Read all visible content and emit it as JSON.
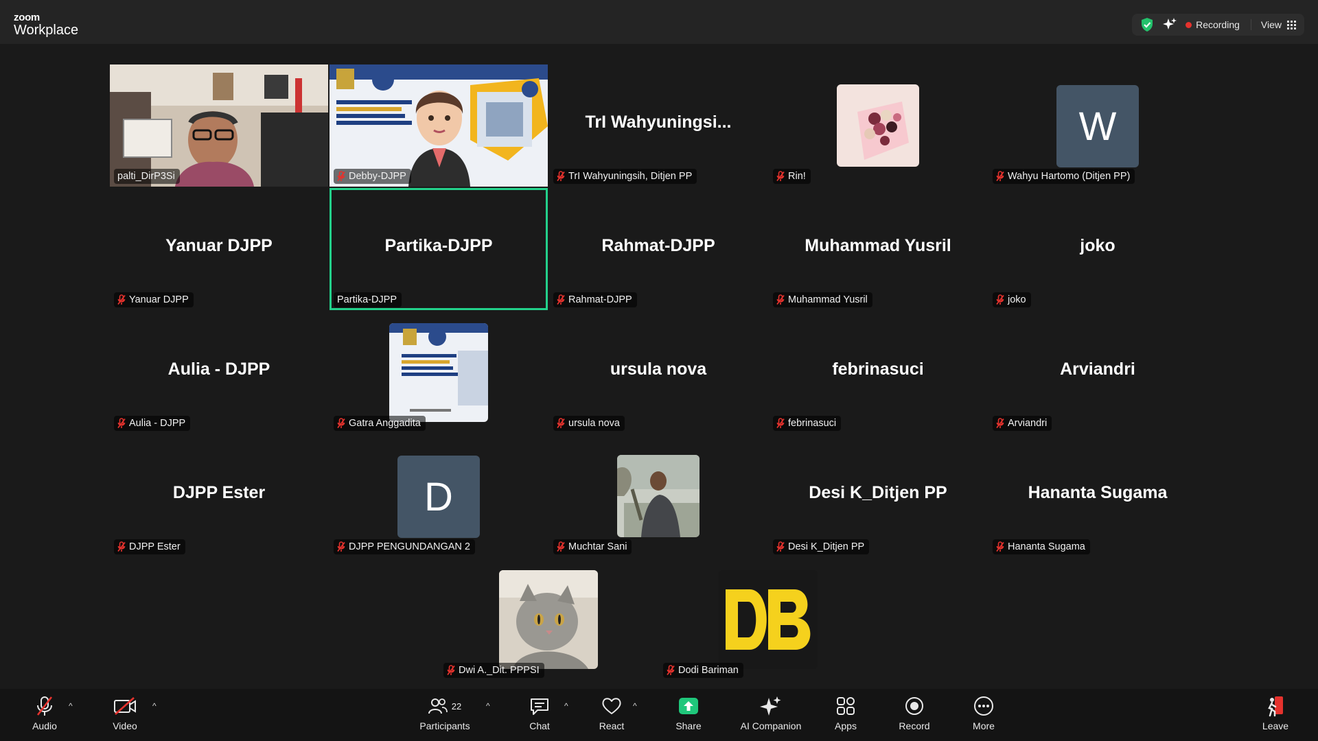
{
  "app": {
    "brand_small": "zoom",
    "brand_main": "Workplace"
  },
  "top_bar": {
    "recording_label": "Recording",
    "view_label": "View"
  },
  "tiles": [
    {
      "name": "palti_DirP3Si",
      "type": "video-person",
      "muted": false,
      "big": ""
    },
    {
      "name": "Debby-DJPP",
      "type": "avatar-slide",
      "muted": true,
      "big": ""
    },
    {
      "name": "TrI Wahyuningsih, Ditjen PP",
      "type": "text",
      "muted": true,
      "big": "TrI  Wahyuningsi..."
    },
    {
      "name": "Rin!",
      "type": "photo-flowers",
      "muted": true,
      "big": ""
    },
    {
      "name": "Wahyu Hartomo (Ditjen PP)",
      "type": "letter",
      "muted": true,
      "big": "W"
    },
    {
      "name": "Yanuar DJPP",
      "type": "text",
      "muted": true,
      "big": "Yanuar DJPP"
    },
    {
      "name": "Partika-DJPP",
      "type": "text",
      "muted": false,
      "big": "Partika-DJPP",
      "active": true
    },
    {
      "name": "Rahmat-DJPP",
      "type": "text",
      "muted": true,
      "big": "Rahmat-DJPP"
    },
    {
      "name": "Muhammad Yusril",
      "type": "text",
      "muted": true,
      "big": "Muhammad Yusril"
    },
    {
      "name": "joko",
      "type": "text",
      "muted": true,
      "big": "joko"
    },
    {
      "name": "Aulia - DJPP",
      "type": "text",
      "muted": true,
      "big": "Aulia - DJPP"
    },
    {
      "name": "Gatra Anggadita",
      "type": "photo-slide",
      "muted": true,
      "big": ""
    },
    {
      "name": "ursula nova",
      "type": "text",
      "muted": true,
      "big": "ursula nova"
    },
    {
      "name": "febrinasuci",
      "type": "text",
      "muted": true,
      "big": "febrinasuci"
    },
    {
      "name": "Arviandri",
      "type": "text",
      "muted": true,
      "big": "Arviandri"
    },
    {
      "name": "DJPP Ester",
      "type": "text",
      "muted": true,
      "big": "DJPP Ester"
    },
    {
      "name": "DJPP PENGUNDANGAN 2",
      "type": "letter",
      "muted": true,
      "big": "D"
    },
    {
      "name": "Muchtar Sani",
      "type": "photo-man",
      "muted": true,
      "big": ""
    },
    {
      "name": "Desi K_Ditjen PP",
      "type": "text",
      "muted": true,
      "big": "Desi K_Ditjen PP"
    },
    {
      "name": "Hananta Sugama",
      "type": "text",
      "muted": true,
      "big": "Hananta Sugama"
    },
    {
      "name": "Dwi A._Dit. PPPSI",
      "type": "photo-cat",
      "muted": true,
      "big": ""
    },
    {
      "name": "Dodi Bariman",
      "type": "photo-db",
      "muted": true,
      "big": ""
    }
  ],
  "toolbar": {
    "audio": "Audio",
    "video": "Video",
    "participants": "Participants",
    "participants_count": "22",
    "chat": "Chat",
    "react": "React",
    "share": "Share",
    "ai_companion": "AI Companion",
    "apps": "Apps",
    "record": "Record",
    "more": "More",
    "leave": "Leave"
  },
  "colors": {
    "active_speaker": "#23d18b",
    "recording_dot": "#e5322d",
    "share_green": "#1fc77b",
    "leave_red": "#e5322d",
    "letter_avatar_bg": "#445566"
  }
}
